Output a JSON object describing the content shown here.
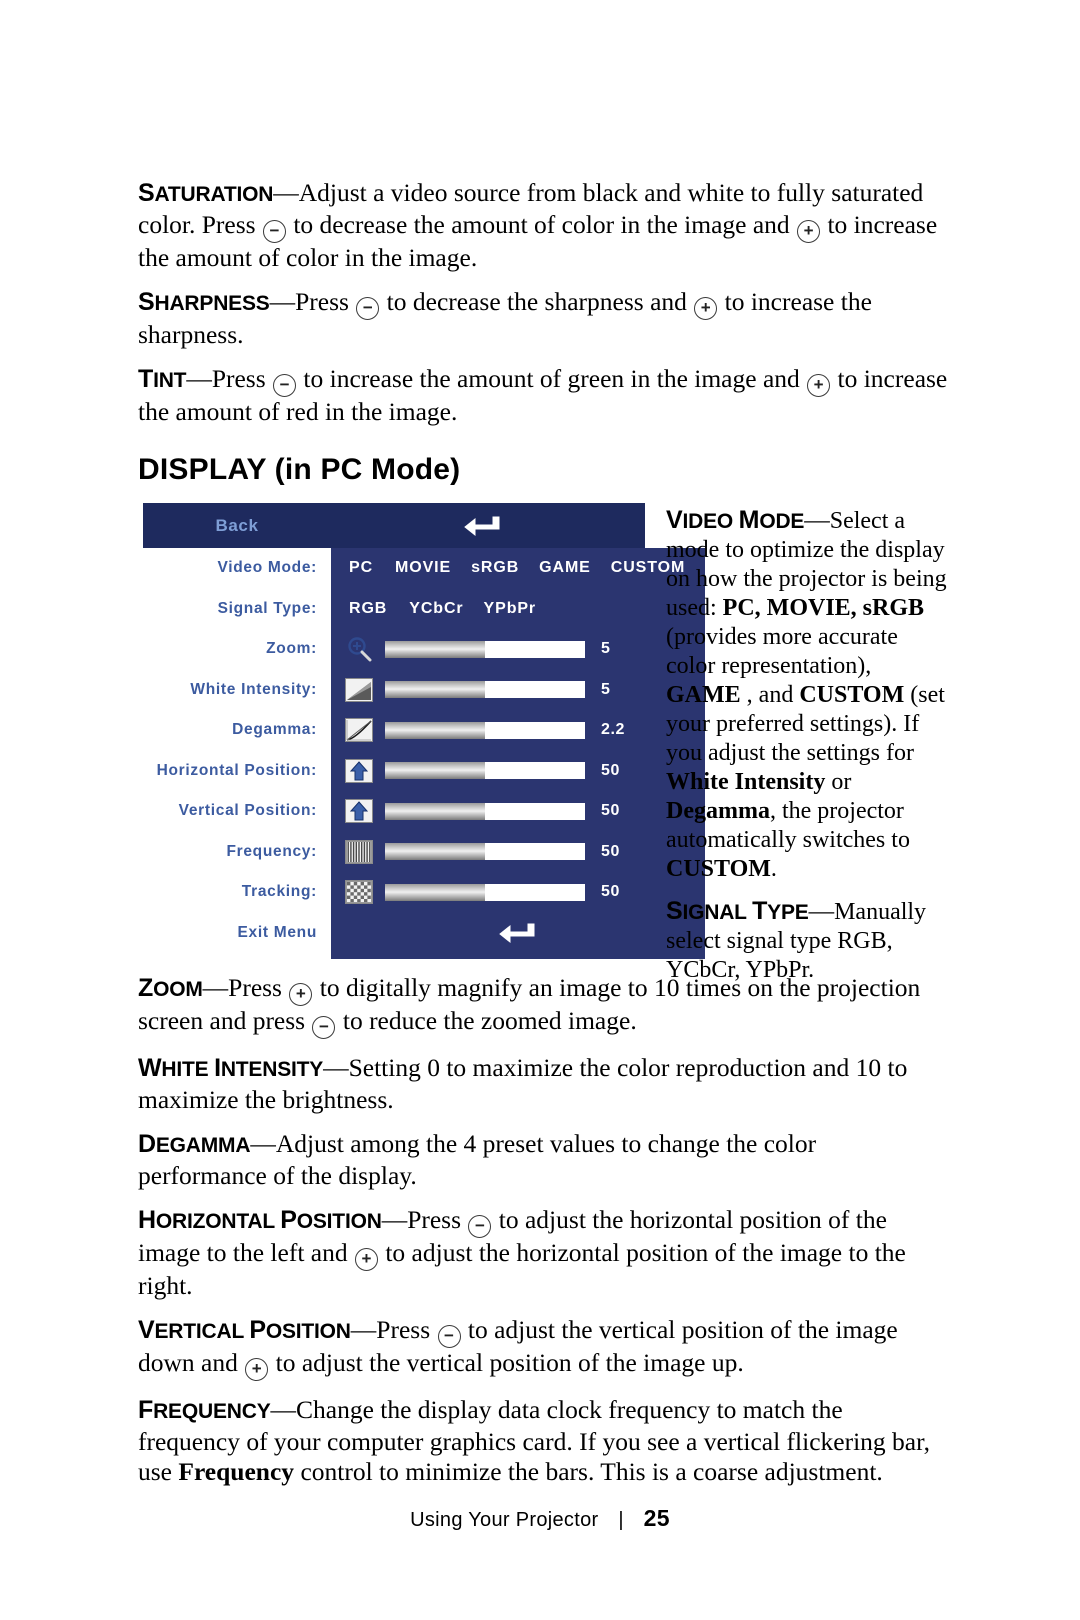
{
  "page": {
    "footer_section": "Using Your Projector",
    "footer_separator": "|",
    "footer_page_number": "25"
  },
  "paragraphs_top": [
    {
      "term": "SATURATION",
      "dash": "—",
      "parts": [
        {
          "t": "text",
          "v": "Adjust a video source from black and white to fully saturated color. Press "
        },
        {
          "t": "key",
          "v": "−"
        },
        {
          "t": "text",
          "v": " to decrease the amount of color in the image and "
        },
        {
          "t": "key",
          "v": "+"
        },
        {
          "t": "text",
          "v": " to increase the amount of color in the image."
        }
      ]
    },
    {
      "term": "SHARPNESS",
      "dash": "—",
      "parts": [
        {
          "t": "text",
          "v": "Press "
        },
        {
          "t": "key",
          "v": "−"
        },
        {
          "t": "text",
          "v": " to decrease the sharpness and "
        },
        {
          "t": "key",
          "v": "+"
        },
        {
          "t": "text",
          "v": " to increase the sharpness."
        }
      ]
    },
    {
      "term": "TINT",
      "dash": "—",
      "parts": [
        {
          "t": "text",
          "v": "Press "
        },
        {
          "t": "key",
          "v": "−"
        },
        {
          "t": "text",
          "v": " to increase the amount of green in the image and "
        },
        {
          "t": "key",
          "v": "+"
        },
        {
          "t": "text",
          "v": " to increase the amount of red in the image."
        }
      ]
    }
  ],
  "section_heading": "DISPLAY (in PC Mode)",
  "osd": {
    "header": {
      "back_label": "Back",
      "icon": "return-arrow-icon"
    },
    "rows": [
      {
        "label": "Video Mode:",
        "type": "options",
        "options": [
          "PC",
          "MOVIE",
          "sRGB",
          "GAME",
          "CUSTOM"
        ]
      },
      {
        "label": "Signal Type:",
        "type": "options",
        "options": [
          "RGB",
          "YCbCr",
          "YPbPr"
        ]
      },
      {
        "label": "Zoom:",
        "type": "slider",
        "icon": "magnifier-plus-icon",
        "value": "5",
        "fill_percent": 50
      },
      {
        "label": "White Intensity:",
        "type": "slider",
        "icon": "white-intensity-icon",
        "value": "5",
        "fill_percent": 50
      },
      {
        "label": "Degamma:",
        "type": "slider",
        "icon": "degamma-curve-icon",
        "value": "2.2",
        "fill_percent": 50
      },
      {
        "label": "Horizontal Position:",
        "type": "slider",
        "icon": "horizontal-position-arrow-icon",
        "value": "50",
        "fill_percent": 50
      },
      {
        "label": "Vertical Position:",
        "type": "slider",
        "icon": "vertical-position-arrow-icon",
        "value": "50",
        "fill_percent": 50
      },
      {
        "label": "Frequency:",
        "type": "slider",
        "icon": "frequency-stripes-icon",
        "value": "50",
        "fill_percent": 50
      },
      {
        "label": "Tracking:",
        "type": "slider",
        "icon": "tracking-pattern-icon",
        "value": "50",
        "fill_percent": 50
      }
    ],
    "exit": {
      "label": "Exit Menu",
      "icon": "return-arrow-icon"
    },
    "colors": {
      "header_bg": "#1e2a5e",
      "panel_bg": "#2b3570",
      "label_bg": "#ffffff",
      "label_text": "#3c5ba0",
      "back_text": "#7e9ed6",
      "option_text": "#ffffff",
      "track_bg": "#ffffff"
    }
  },
  "side_paragraphs": [
    {
      "term": "VIDEO MODE",
      "dash": "—",
      "parts": [
        {
          "t": "text",
          "v": "Select a mode to optimize the display on how the projector is being used: "
        },
        {
          "t": "bold",
          "v": "PC, MOVIE, sRGB"
        },
        {
          "t": "text",
          "v": " (provides more accurate color representation), "
        },
        {
          "t": "bold",
          "v": "GAME"
        },
        {
          "t": "text",
          "v": " , and "
        },
        {
          "t": "bold",
          "v": "CUSTOM"
        },
        {
          "t": "text",
          "v": " (set your preferred settings). If you adjust the settings for "
        },
        {
          "t": "bold",
          "v": "White Intensity"
        },
        {
          "t": "text",
          "v": " or "
        },
        {
          "t": "bold",
          "v": "Degamma"
        },
        {
          "t": "text",
          "v": ", the projector automatically switches to "
        },
        {
          "t": "bold",
          "v": "CUSTOM"
        },
        {
          "t": "text",
          "v": "."
        }
      ]
    },
    {
      "term": "SIGNAL TYPE",
      "dash": "—",
      "parts": [
        {
          "t": "text",
          "v": "Manually select signal type RGB, YCbCr, YPbPr."
        }
      ]
    }
  ],
  "paragraphs_bottom": [
    {
      "term": "ZOOM",
      "dash": "—",
      "parts": [
        {
          "t": "text",
          "v": "Press "
        },
        {
          "t": "key",
          "v": "+"
        },
        {
          "t": "text",
          "v": " to digitally magnify an image to 10 times on the projection screen and press "
        },
        {
          "t": "key",
          "v": "−"
        },
        {
          "t": "text",
          "v": " to reduce the zoomed image."
        }
      ]
    },
    {
      "term": "WHITE INTENSITY",
      "dash": "—",
      "parts": [
        {
          "t": "text",
          "v": "Setting 0 to maximize the color reproduction and 10 to maximize the brightness."
        }
      ]
    },
    {
      "term": "DEGAMMA",
      "dash": "—",
      "parts": [
        {
          "t": "text",
          "v": "Adjust among the 4 preset values to change the color performance of the display."
        }
      ]
    },
    {
      "term": "HORIZONTAL POSITION",
      "dash": "—",
      "parts": [
        {
          "t": "text",
          "v": "Press "
        },
        {
          "t": "key",
          "v": "−"
        },
        {
          "t": "text",
          "v": " to adjust the horizontal position of the image to the left and "
        },
        {
          "t": "key",
          "v": "+"
        },
        {
          "t": "text",
          "v": " to adjust the horizontal position of the image to the right."
        }
      ]
    },
    {
      "term": "VERTICAL POSITION",
      "dash": "—",
      "parts": [
        {
          "t": "text",
          "v": "Press "
        },
        {
          "t": "key",
          "v": "−"
        },
        {
          "t": "text",
          "v": " to adjust the vertical position of the image down and "
        },
        {
          "t": "key",
          "v": "+"
        },
        {
          "t": "text",
          "v": " to adjust the vertical position of the image up."
        }
      ]
    },
    {
      "term": "FREQUENCY",
      "dash": "—",
      "parts": [
        {
          "t": "text",
          "v": "Change the display data clock frequency to match the frequency of your computer graphics card. If you see a vertical flickering bar, use "
        },
        {
          "t": "bold",
          "v": "Frequency"
        },
        {
          "t": "text",
          "v": " control to minimize the bars. This is a coarse adjustment."
        }
      ]
    }
  ]
}
